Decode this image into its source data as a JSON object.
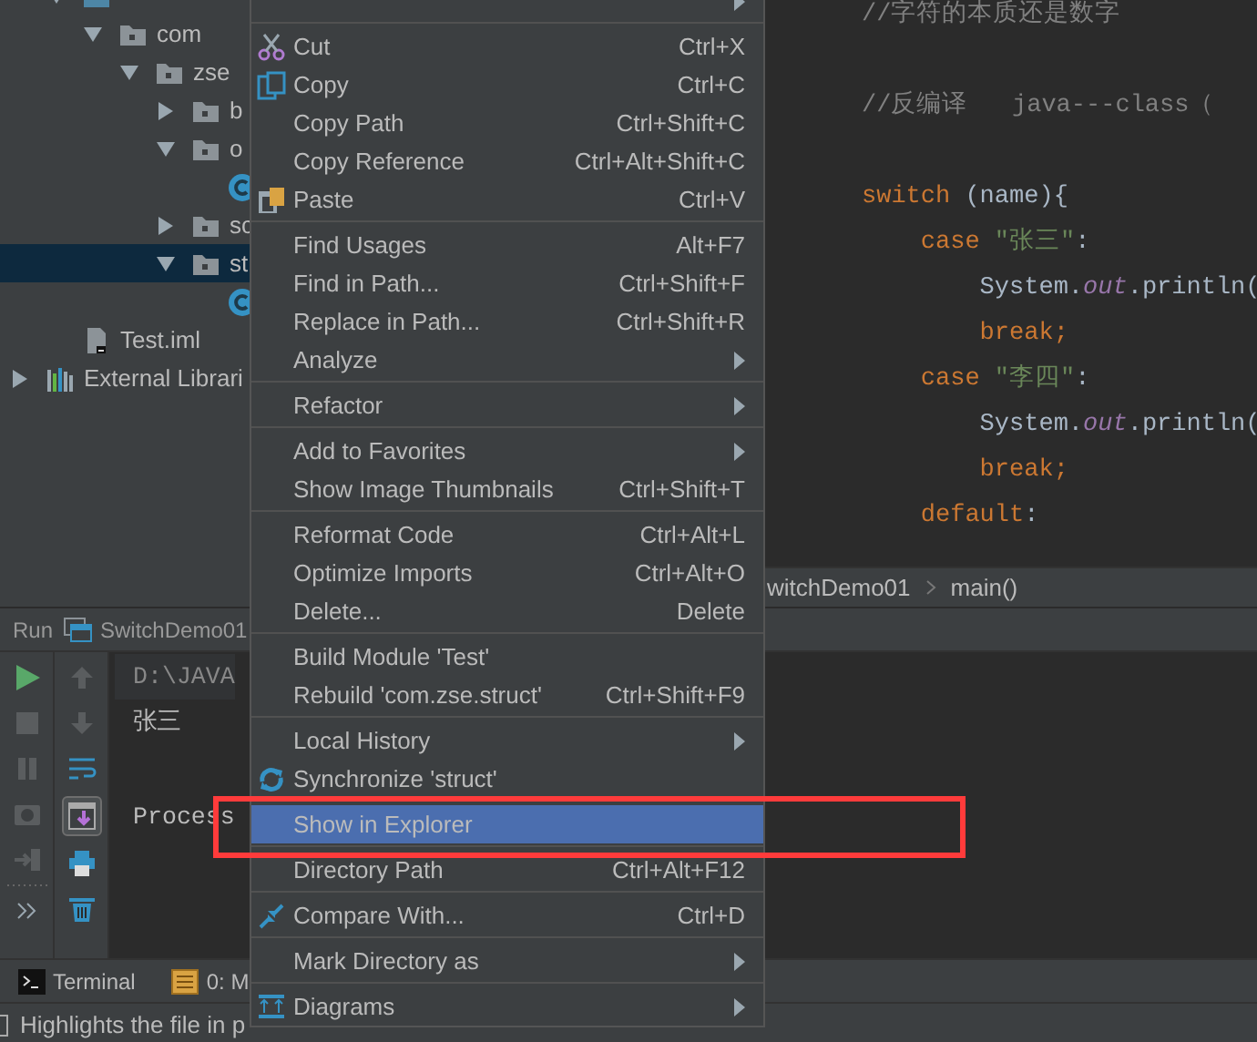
{
  "project_tree": {
    "items": [
      {
        "kind": "source_root",
        "expanded": true,
        "selected": false,
        "children": [
          {
            "kind": "package",
            "label": "com",
            "expanded": true,
            "selected": false,
            "children": [
              {
                "kind": "package",
                "label": "zse",
                "expanded": true,
                "selected": false,
                "children": [
                  {
                    "kind": "package",
                    "label": "b",
                    "expanded": false,
                    "selected": false
                  },
                  {
                    "kind": "package",
                    "label": "o",
                    "expanded": true,
                    "selected": false,
                    "children": [
                      {
                        "kind": "class",
                        "selected": false
                      }
                    ]
                  },
                  {
                    "kind": "package",
                    "label": "sc",
                    "expanded": false,
                    "selected": false
                  },
                  {
                    "kind": "package",
                    "label": "st",
                    "expanded": true,
                    "selected": true,
                    "children": [
                      {
                        "kind": "class",
                        "selected": false
                      }
                    ]
                  }
                ]
              }
            ]
          }
        ]
      },
      {
        "kind": "file",
        "label": "Test.iml",
        "selected": false
      },
      {
        "kind": "library",
        "label": "External Librari",
        "expanded": false,
        "selected": false
      }
    ]
  },
  "editor": {
    "lines": [
      {
        "kind": "code",
        "tokens": [
          {
            "text": "//字符的本质还是数字",
            "kind": "comment"
          }
        ]
      },
      {
        "kind": "blank"
      },
      {
        "kind": "code",
        "tokens": [
          {
            "text": "//反编译   java---class（",
            "kind": "comment"
          }
        ]
      },
      {
        "kind": "blank"
      },
      {
        "kind": "code",
        "tokens": [
          {
            "text": "switch",
            "kind": "keyword"
          },
          {
            "text": " (name){",
            "kind": "plain"
          }
        ]
      },
      {
        "kind": "code",
        "tokens": [
          {
            "text": "    case ",
            "kind": "keyword"
          },
          {
            "text": "\"张三\"",
            "kind": "string"
          },
          {
            "text": ":",
            "kind": "plain"
          }
        ]
      },
      {
        "kind": "code",
        "tokens": [
          {
            "text": "        System.",
            "kind": "plain"
          },
          {
            "text": "out",
            "kind": "field"
          },
          {
            "text": ".println(",
            "kind": "plain"
          }
        ]
      },
      {
        "kind": "code",
        "tokens": [
          {
            "text": "        break;",
            "kind": "keyword"
          }
        ]
      },
      {
        "kind": "code",
        "tokens": [
          {
            "text": "    case ",
            "kind": "keyword"
          },
          {
            "text": "\"李四\"",
            "kind": "string"
          },
          {
            "text": ":",
            "kind": "plain"
          }
        ]
      },
      {
        "kind": "code",
        "tokens": [
          {
            "text": "        System.",
            "kind": "plain"
          },
          {
            "text": "out",
            "kind": "field"
          },
          {
            "text": ".println(",
            "kind": "plain"
          }
        ]
      },
      {
        "kind": "code",
        "tokens": [
          {
            "text": "        break;",
            "kind": "keyword"
          }
        ]
      },
      {
        "kind": "code",
        "tokens": [
          {
            "text": "    default",
            "kind": "keyword"
          },
          {
            "text": ":",
            "kind": "plain"
          }
        ]
      }
    ],
    "breadcrumbs": [
      "witchDemo01",
      "main()"
    ]
  },
  "run_panel": {
    "label": "Run",
    "config": "SwitchDemo01",
    "scroll_to_end_on": true,
    "console": [
      {
        "kind": "command",
        "text": "D:\\JAVA"
      },
      {
        "kind": "output",
        "text": "张三"
      },
      {
        "kind": "exit",
        "text": "Process"
      }
    ]
  },
  "tool_tabs": [
    {
      "label": "Terminal"
    },
    {
      "label": "0: M"
    }
  ],
  "status_bar": {
    "text": "Highlights the file in p"
  },
  "context_menu": {
    "items": [
      {
        "kind": "item",
        "submenu": true,
        "selected": false
      },
      {
        "kind": "separator"
      },
      {
        "kind": "item",
        "label": "Cut",
        "shortcut": "Ctrl+X",
        "submenu": false,
        "selected": false
      },
      {
        "kind": "item",
        "label": "Copy",
        "shortcut": "Ctrl+C",
        "submenu": false,
        "selected": false
      },
      {
        "kind": "item",
        "label": "Copy Path",
        "shortcut": "Ctrl+Shift+C",
        "submenu": false,
        "selected": false
      },
      {
        "kind": "item",
        "label": "Copy Reference",
        "shortcut": "Ctrl+Alt+Shift+C",
        "submenu": false,
        "selected": false
      },
      {
        "kind": "item",
        "label": "Paste",
        "shortcut": "Ctrl+V",
        "submenu": false,
        "selected": false
      },
      {
        "kind": "separator"
      },
      {
        "kind": "item",
        "label": "Find Usages",
        "shortcut": "Alt+F7",
        "submenu": false,
        "selected": false
      },
      {
        "kind": "item",
        "label": "Find in Path...",
        "shortcut": "Ctrl+Shift+F",
        "submenu": false,
        "selected": false
      },
      {
        "kind": "item",
        "label": "Replace in Path...",
        "shortcut": "Ctrl+Shift+R",
        "submenu": false,
        "selected": false
      },
      {
        "kind": "item",
        "label": "Analyze",
        "submenu": true,
        "selected": false
      },
      {
        "kind": "separator"
      },
      {
        "kind": "item",
        "label": "Refactor",
        "submenu": true,
        "selected": false
      },
      {
        "kind": "separator"
      },
      {
        "kind": "item",
        "label": "Add to Favorites",
        "submenu": true,
        "selected": false
      },
      {
        "kind": "item",
        "label": "Show Image Thumbnails",
        "shortcut": "Ctrl+Shift+T",
        "submenu": false,
        "selected": false
      },
      {
        "kind": "separator"
      },
      {
        "kind": "item",
        "label": "Reformat Code",
        "shortcut": "Ctrl+Alt+L",
        "submenu": false,
        "selected": false
      },
      {
        "kind": "item",
        "label": "Optimize Imports",
        "shortcut": "Ctrl+Alt+O",
        "submenu": false,
        "selected": false
      },
      {
        "kind": "item",
        "label": "Delete...",
        "shortcut": "Delete",
        "submenu": false,
        "selected": false
      },
      {
        "kind": "separator"
      },
      {
        "kind": "item",
        "label": "Build Module 'Test'",
        "submenu": false,
        "selected": false
      },
      {
        "kind": "item",
        "label": "Rebuild 'com.zse.struct'",
        "shortcut": "Ctrl+Shift+F9",
        "submenu": false,
        "selected": false
      },
      {
        "kind": "separator"
      },
      {
        "kind": "item",
        "label": "Local History",
        "submenu": true,
        "selected": false
      },
      {
        "kind": "item",
        "label": "Synchronize 'struct'",
        "submenu": false,
        "selected": false
      },
      {
        "kind": "separator"
      },
      {
        "kind": "item",
        "label": "Show in Explorer",
        "submenu": false,
        "selected": true
      },
      {
        "kind": "separator"
      },
      {
        "kind": "item",
        "label": "Directory Path",
        "shortcut": "Ctrl+Alt+F12",
        "submenu": false,
        "selected": false
      },
      {
        "kind": "separator"
      },
      {
        "kind": "item",
        "label": "Compare With...",
        "shortcut": "Ctrl+D",
        "submenu": false,
        "selected": false
      },
      {
        "kind": "separator"
      },
      {
        "kind": "item",
        "label": "Mark Directory as",
        "submenu": true,
        "selected": false
      },
      {
        "kind": "separator"
      },
      {
        "kind": "item",
        "label": "Diagrams",
        "submenu": true,
        "selected": false
      }
    ]
  }
}
